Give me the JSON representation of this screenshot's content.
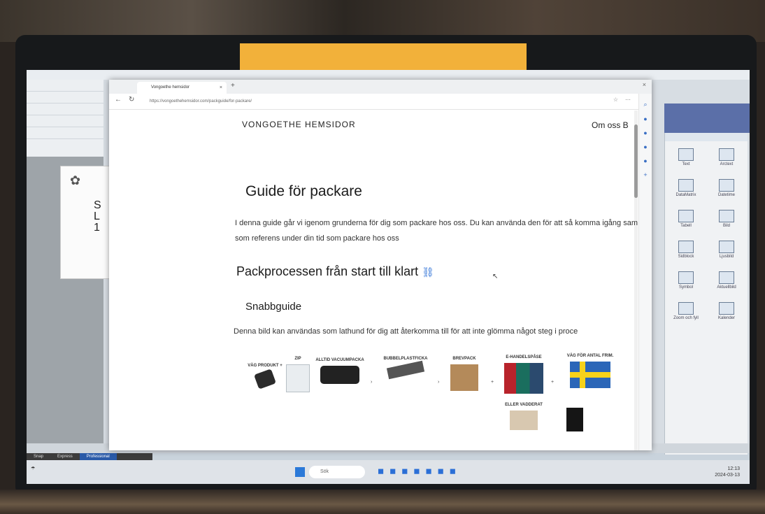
{
  "browser": {
    "tab_title": "Vongoethe hemsidor",
    "url": "https://vongoethehemsidor.com/packguide/for-packare/"
  },
  "site": {
    "brand": "VONGOETHE HEMSIDOR",
    "nav_item": "Om oss   B"
  },
  "article": {
    "title": "Guide för packare",
    "intro": "I denna guide går vi igenom grunderna för dig som packare hos oss. Du kan använda den för att så komma igång samt som referens under din tid som packare hos oss",
    "section_heading": "Packprocessen från start till klart",
    "subheading": "Snabbguide",
    "caption": "Denna bild kan användas som lathund för dig att återkomma till för att inte glömma något steg i proce"
  },
  "guide_steps": [
    {
      "label": "VÄG PRODUKT +"
    },
    {
      "label": "ZIP"
    },
    {
      "label": "ALLTID VACUUMPACKA"
    },
    {
      "label": "BUBBELPLASTFICKA"
    },
    {
      "label": "BREVPACK"
    },
    {
      "label": "E-HANDELSPÅSE"
    },
    {
      "label": "VÄG FÖR ANTAL FRIM."
    },
    {
      "label": "ELLER VADDERAT"
    }
  ],
  "bg_app": {
    "label_letters": [
      "S",
      "L",
      "1"
    ]
  },
  "right_panel": {
    "tiles": [
      "Text",
      "Arctext",
      "DataMatrix",
      "Datetime",
      "Tabell",
      "Bild",
      "Sidblock",
      "Ljusbild",
      "Symbol",
      "Aktuellbild",
      "Zoom och fyll",
      "Kalender"
    ]
  },
  "app_modes": [
    "Snap",
    "Express",
    "Professional"
  ],
  "taskbar": {
    "search_placeholder": "Sök",
    "tray_time": "12:13",
    "tray_date": "2024-03-13"
  },
  "colors": {
    "accent": "#2b6fd6",
    "tape": "#f2b13a",
    "pro_tab": "#2a5aa8"
  }
}
